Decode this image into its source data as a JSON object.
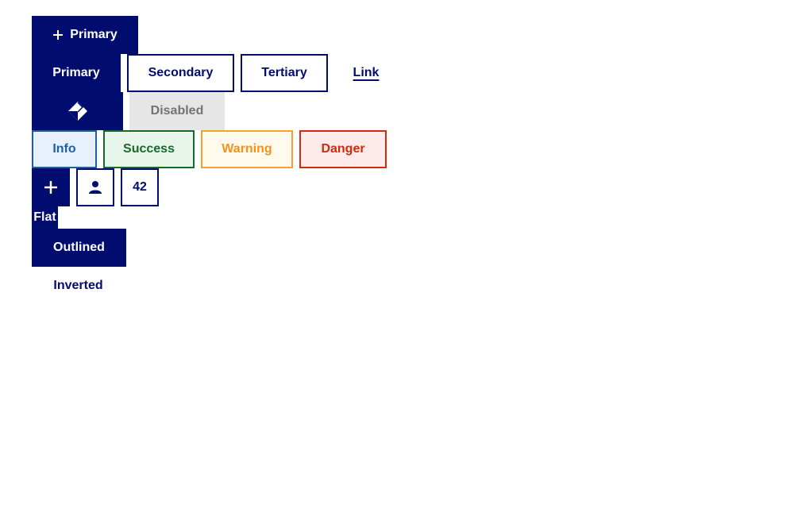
{
  "buttons": {
    "primary_with_icon": {
      "label": "Primary",
      "icon": "plus-icon"
    },
    "primary": {
      "label": "Primary"
    },
    "secondary": {
      "label": "Secondary"
    },
    "tertiary": {
      "label": "Tertiary"
    },
    "link": {
      "label": "Link"
    },
    "icon_only": {
      "icon": "move-diamond-icon"
    },
    "disabled": {
      "label": "Disabled"
    },
    "info": {
      "label": "Info"
    },
    "success": {
      "label": "Success"
    },
    "warning": {
      "label": "Warning"
    },
    "danger": {
      "label": "Danger"
    },
    "square_plus": {
      "icon": "plus-icon"
    },
    "square_user": {
      "icon": "user-icon"
    },
    "square_count": {
      "label": "42"
    },
    "flat": {
      "label": "Flat"
    },
    "outlined": {
      "label": "Outlined"
    },
    "inverted": {
      "label": "Inverted"
    }
  },
  "colors": {
    "brand": "#000d6e",
    "disabled_bg": "#e6e6e6",
    "info": "#1f5fa6",
    "success": "#166a2a",
    "warning": "#f5921d",
    "danger": "#d12b0c"
  }
}
